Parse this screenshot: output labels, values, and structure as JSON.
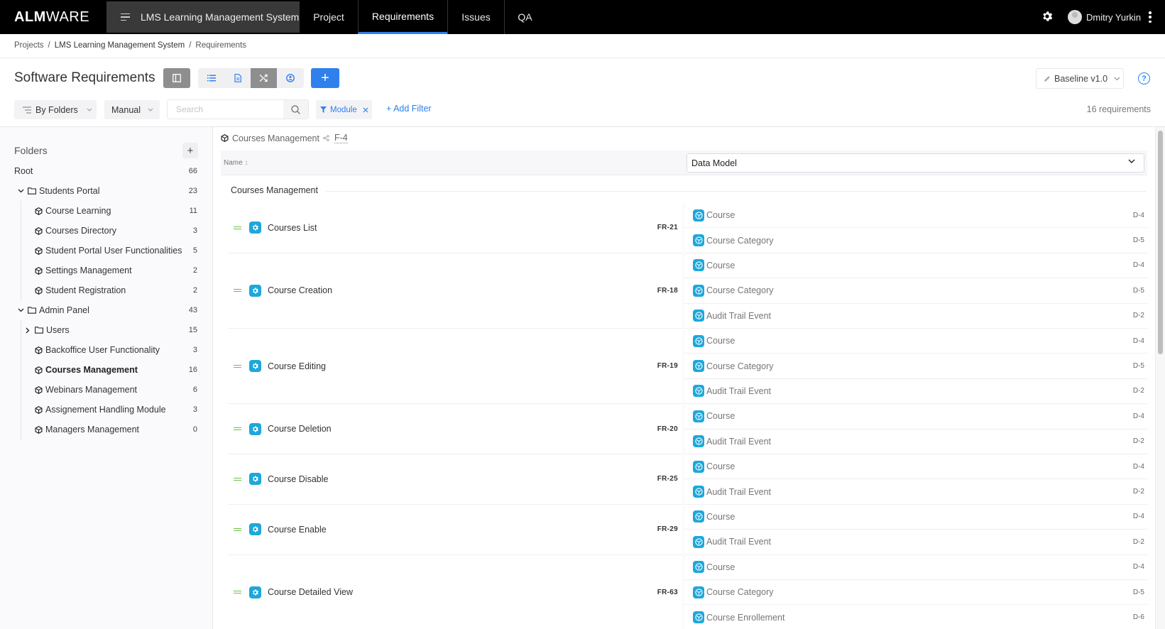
{
  "app": {
    "logo_bold": "ALM",
    "logo_light": "WARE",
    "project_name": "LMS Learning Management System",
    "nav_tabs": [
      {
        "label": "Project",
        "active": false
      },
      {
        "label": "Requirements",
        "active": true
      },
      {
        "label": "Issues",
        "active": false
      },
      {
        "label": "QA",
        "active": false
      }
    ],
    "user_name": "Dmitry Yurkin",
    "accent_color": "#2f80ed"
  },
  "breadcrumb": [
    "Projects",
    "LMS Learning Management System",
    "Requirements"
  ],
  "page": {
    "title": "Software Requirements",
    "baseline_label": "Baseline v1.0",
    "help_label": "?",
    "add_label": "+"
  },
  "filters": {
    "group_by": "By Folders",
    "sort_mode": "Manual",
    "search_placeholder": "Search",
    "search_value": "",
    "active_filter": "Module",
    "add_filter_label": "+ Add Filter",
    "count_label": "16 requirements"
  },
  "sidebar": {
    "title": "Folders",
    "add_label": "+",
    "items": [
      {
        "label": "Root",
        "count": "66",
        "type": "root",
        "level": 0
      },
      {
        "label": "Students Portal",
        "count": "23",
        "type": "folder",
        "level": 1,
        "expanded": true
      },
      {
        "label": "Course Learning",
        "count": "11",
        "type": "module",
        "level": 2
      },
      {
        "label": "Courses Directory",
        "count": "3",
        "type": "module",
        "level": 2
      },
      {
        "label": "Student Portal User Functionalities",
        "count": "5",
        "type": "module",
        "level": 2
      },
      {
        "label": "Settings Management",
        "count": "2",
        "type": "module",
        "level": 2
      },
      {
        "label": "Student Registration",
        "count": "2",
        "type": "module",
        "level": 2
      },
      {
        "label": "Admin Panel",
        "count": "43",
        "type": "folder",
        "level": 1,
        "expanded": true
      },
      {
        "label": "Users",
        "count": "15",
        "type": "folder",
        "level": 2,
        "expanded": false
      },
      {
        "label": "Backoffice User Functionality",
        "count": "3",
        "type": "module",
        "level": 2
      },
      {
        "label": "Courses Management",
        "count": "16",
        "type": "module",
        "level": 2,
        "selected": true
      },
      {
        "label": "Webinars Management",
        "count": "6",
        "type": "module",
        "level": 2
      },
      {
        "label": "Assignement Handling Module",
        "count": "3",
        "type": "module",
        "level": 2
      },
      {
        "label": "Managers Management",
        "count": "0",
        "type": "module",
        "level": 2
      }
    ]
  },
  "main": {
    "scope_name": "Courses Management",
    "scope_id": "F-4",
    "name_column": "Name",
    "trace_column": "Data Model",
    "group_title": "Courses Management",
    "requirements": [
      {
        "name": "Courses List",
        "id": "FR-21",
        "links": [
          {
            "name": "Course",
            "id": "D-4"
          },
          {
            "name": "Course Category",
            "id": "D-5"
          }
        ]
      },
      {
        "name": "Course Creation",
        "id": "FR-18",
        "links": [
          {
            "name": "Course",
            "id": "D-4"
          },
          {
            "name": "Course Category",
            "id": "D-5"
          },
          {
            "name": "Audit Trail Event",
            "id": "D-2"
          }
        ]
      },
      {
        "name": "Course Editing",
        "id": "FR-19",
        "links": [
          {
            "name": "Course",
            "id": "D-4"
          },
          {
            "name": "Course Category",
            "id": "D-5"
          },
          {
            "name": "Audit Trail Event",
            "id": "D-2"
          }
        ]
      },
      {
        "name": "Course Deletion",
        "id": "FR-20",
        "links": [
          {
            "name": "Course",
            "id": "D-4"
          },
          {
            "name": "Audit Trail Event",
            "id": "D-2"
          }
        ]
      },
      {
        "name": "Course Disable",
        "id": "FR-25",
        "links": [
          {
            "name": "Course",
            "id": "D-4"
          },
          {
            "name": "Audit Trail Event",
            "id": "D-2"
          }
        ]
      },
      {
        "name": "Course Enable",
        "id": "FR-29",
        "links": [
          {
            "name": "Course",
            "id": "D-4"
          },
          {
            "name": "Audit Trail Event",
            "id": "D-2"
          }
        ]
      },
      {
        "name": "Course Detailed View",
        "id": "FR-63",
        "links": [
          {
            "name": "Course",
            "id": "D-4"
          },
          {
            "name": "Course Category",
            "id": "D-5"
          },
          {
            "name": "Course Enrollement",
            "id": "D-6"
          }
        ]
      }
    ]
  }
}
